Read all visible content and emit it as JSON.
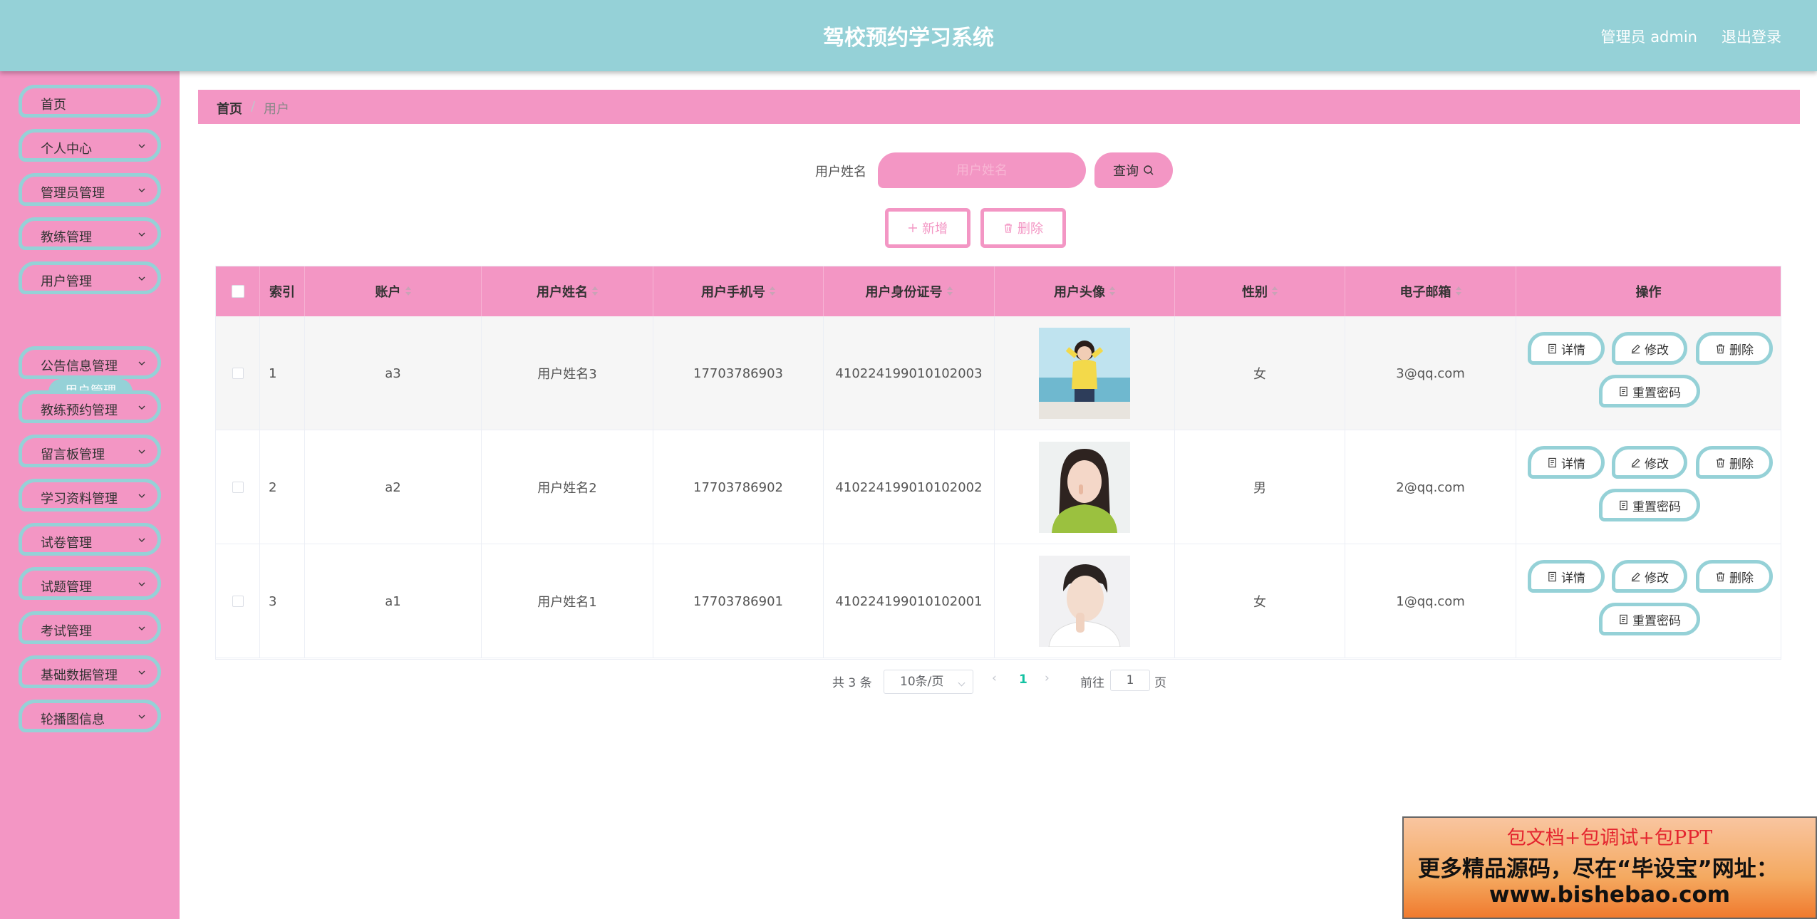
{
  "header": {
    "title": "驾校预约学习系统",
    "admin": "管理员 admin",
    "logout": "退出登录"
  },
  "sidebar": {
    "items": [
      {
        "label": "首页",
        "icon": ""
      },
      {
        "label": "个人中心",
        "icon": "chevron-down-icon"
      },
      {
        "label": "管理员管理",
        "icon": "chevron-down-icon"
      },
      {
        "label": "教练管理",
        "icon": "chevron-down-icon"
      },
      {
        "label": "用户管理",
        "icon": "chevron-down-icon"
      },
      {
        "label": "公告信息管理",
        "icon": "chevron-down-icon"
      },
      {
        "label": "教练预约管理",
        "icon": "chevron-down-icon"
      },
      {
        "label": "留言板管理",
        "icon": "chevron-down-icon"
      },
      {
        "label": "学习资料管理",
        "icon": "chevron-down-icon"
      },
      {
        "label": "试卷管理",
        "icon": "chevron-down-icon"
      },
      {
        "label": "试题管理",
        "icon": "chevron-down-icon"
      },
      {
        "label": "考试管理",
        "icon": "chevron-down-icon"
      },
      {
        "label": "基础数据管理",
        "icon": "chevron-down-icon"
      },
      {
        "label": "轮播图信息",
        "icon": "chevron-down-icon"
      }
    ],
    "sub_item": "用户管理"
  },
  "breadcrumb": {
    "home": "首页",
    "separator": "/",
    "current": "用户"
  },
  "search": {
    "label": "用户姓名",
    "placeholder": "用户姓名",
    "value": "",
    "button": "查询"
  },
  "actions": {
    "add": "新增",
    "delete": "删除"
  },
  "table": {
    "headers": [
      "索引",
      "账户",
      "用户姓名",
      "用户手机号",
      "用户身份证号",
      "用户头像",
      "性别",
      "电子邮箱",
      "操作"
    ],
    "rows": [
      {
        "index": "1",
        "account": "a3",
        "name": "用户姓名3",
        "phone": "17703786903",
        "id_number": "410224199010102003",
        "avatar": "avatar-photo-girl-yellow",
        "gender": "女",
        "email": "3@qq.com"
      },
      {
        "index": "2",
        "account": "a2",
        "name": "用户姓名2",
        "phone": "17703786902",
        "id_number": "410224199010102002",
        "avatar": "avatar-photo-girl-green",
        "gender": "男",
        "email": "2@qq.com"
      },
      {
        "index": "3",
        "account": "a1",
        "name": "用户姓名1",
        "phone": "17703786901",
        "id_number": "410224199010102001",
        "avatar": "avatar-photo-boy-white",
        "gender": "女",
        "email": "1@qq.com"
      }
    ],
    "row_actions": {
      "detail": "详情",
      "edit": "修改",
      "delete": "删除",
      "reset_password": "重置密码"
    }
  },
  "pagination": {
    "total": "共 3 条",
    "page_size": "10条/页",
    "current_page": "1",
    "goto_label": "前往",
    "goto_value": "1",
    "page_unit": "页"
  },
  "banner": {
    "line1": "包文档+包调试+包PPT",
    "line2": "更多精品源码，尽在“毕设宝”网址：",
    "line3": "www.bishebao.com"
  },
  "colors": {
    "header_bg": "#95d1d7",
    "sidebar_bg": "#f396c4",
    "accent_pink": "#f396c4",
    "accent_teal": "#95d1d7"
  }
}
